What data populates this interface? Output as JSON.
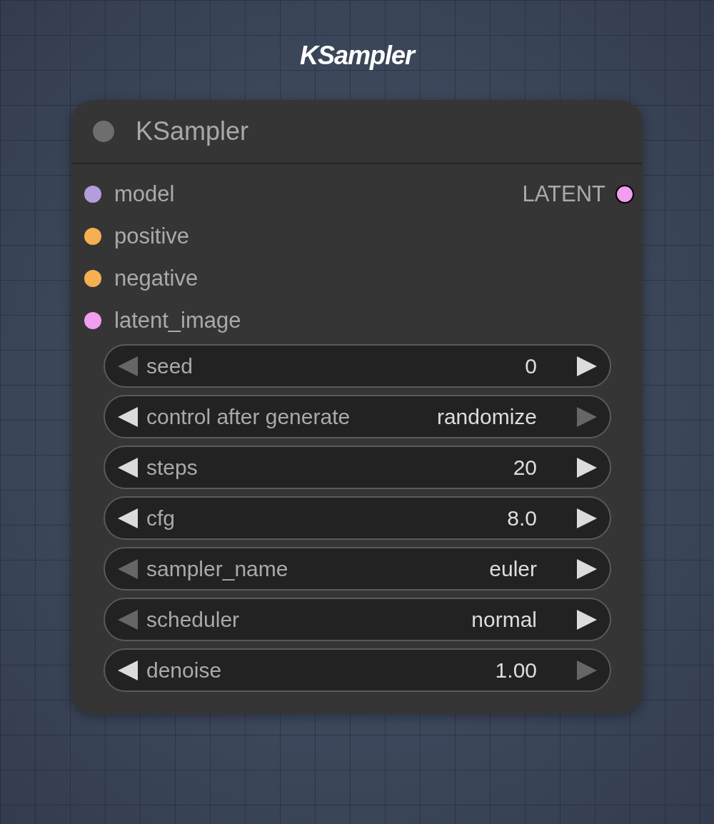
{
  "page_title": "KSampler",
  "node": {
    "title": "KSampler",
    "inputs": [
      {
        "name": "model",
        "color": "#b39ddb"
      },
      {
        "name": "positive",
        "color": "#f5b04f"
      },
      {
        "name": "negative",
        "color": "#f5b04f"
      },
      {
        "name": "latent_image",
        "color": "#f29df0"
      }
    ],
    "outputs": [
      {
        "name": "LATENT",
        "color": "#f29df0"
      }
    ],
    "widgets": [
      {
        "label": "seed",
        "value": "0",
        "left_enabled": false,
        "right_enabled": true
      },
      {
        "label": "control after generate",
        "value": "randomize",
        "left_enabled": true,
        "right_enabled": false
      },
      {
        "label": "steps",
        "value": "20",
        "left_enabled": true,
        "right_enabled": true
      },
      {
        "label": "cfg",
        "value": "8.0",
        "left_enabled": true,
        "right_enabled": true
      },
      {
        "label": "sampler_name",
        "value": "euler",
        "left_enabled": false,
        "right_enabled": true
      },
      {
        "label": "scheduler",
        "value": "normal",
        "left_enabled": false,
        "right_enabled": true
      },
      {
        "label": "denoise",
        "value": "1.00",
        "left_enabled": true,
        "right_enabled": false
      }
    ]
  }
}
